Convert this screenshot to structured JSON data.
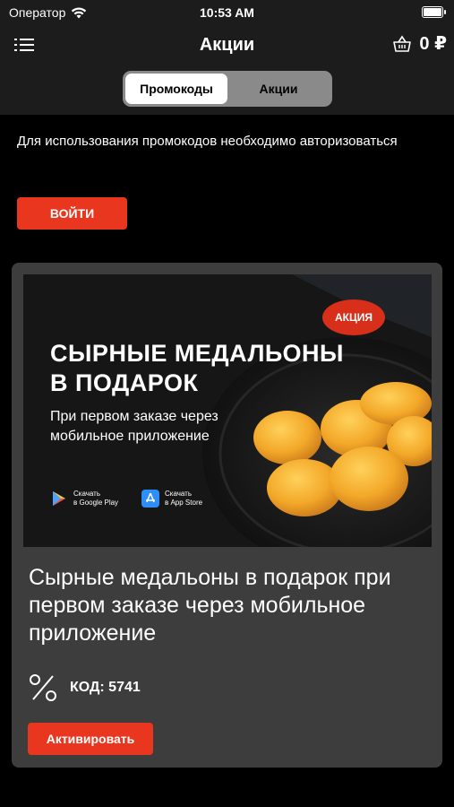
{
  "status_bar": {
    "carrier": "Оператор",
    "time": "10:53 AM"
  },
  "nav": {
    "title": "Акции",
    "cart_total": "0 ₽",
    "menu_icon": "list-menu-icon",
    "cart_icon": "basket-icon"
  },
  "segmented": {
    "tabs": [
      {
        "label": "Промокоды",
        "active": true
      },
      {
        "label": "Акции",
        "active": false
      }
    ]
  },
  "auth": {
    "message": "Для использования промокодов необходимо авторизоваться",
    "login_label": "ВОЙТИ"
  },
  "promo": {
    "banner": {
      "badge": "АКЦИЯ",
      "headline_line1": "СЫРНЫЕ МЕДАЛЬОНЫ",
      "headline_line2": "В ПОДАРОК",
      "subtitle_line1": "При первом заказе через",
      "subtitle_line2": "мобильное приложение",
      "google_play_line1": "Скачать",
      "google_play_line2": "в Google Play",
      "app_store_line1": "Скачать",
      "app_store_line2": "в App Store"
    },
    "title": "Сырные медальоны в подарок при первом заказе через мобильное приложение",
    "code_label": "КОД: 5741",
    "activate_label": "Активировать"
  },
  "colors": {
    "accent": "#e8361f",
    "card_bg": "#3d3d3d",
    "bar_bg": "#1c1c1c",
    "page_bg": "#000000"
  }
}
